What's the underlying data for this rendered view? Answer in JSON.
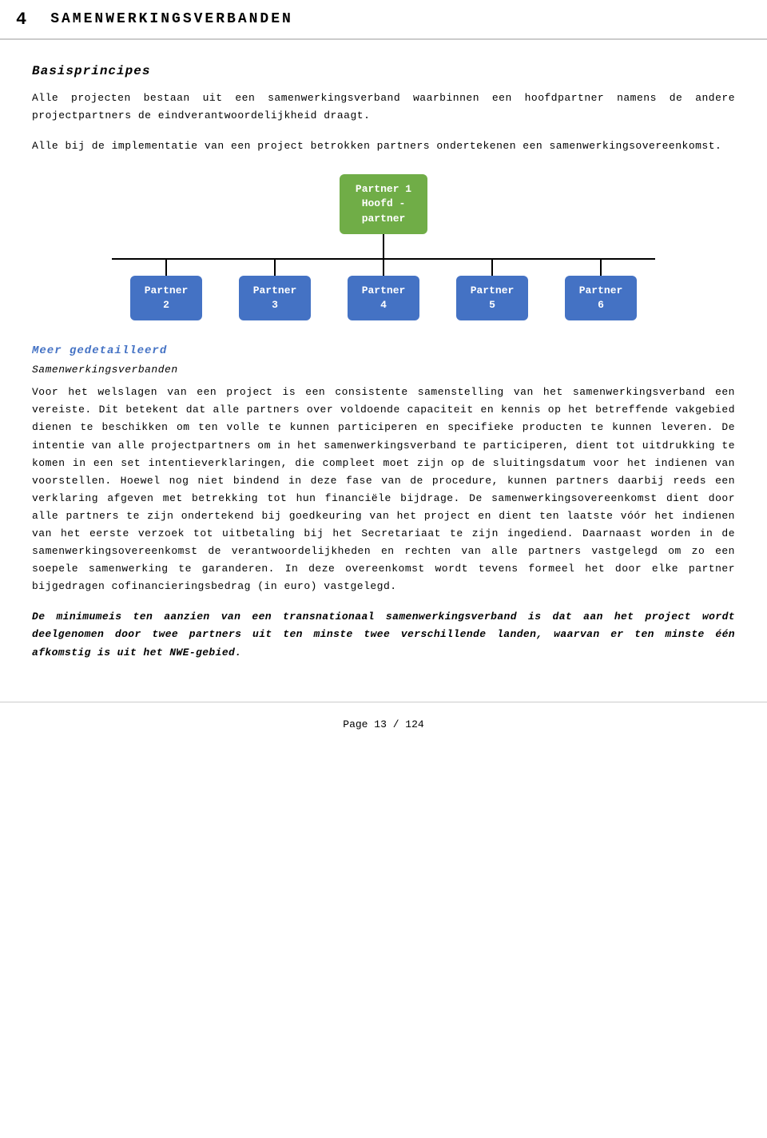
{
  "header": {
    "number": "4",
    "title": "SAMENWERKINGSVERBANDEN"
  },
  "section1": {
    "title": "Basisprincipes",
    "paragraph1": "Alle projecten bestaan uit een samenwerkingsverband waarbinnen een hoofdpartner namens de andere projectpartners de eindverantwoordelijkheid draagt.",
    "paragraph2": "Alle bij de implementatie van een project betrokken partners ondertekenen een samenwerkingsovereenkomst."
  },
  "orgchart": {
    "main_label_line1": "Partner 1",
    "main_label_line2": "Hoofd -",
    "main_label_line3": "partner",
    "partners": [
      {
        "label": "Partner\n2"
      },
      {
        "label": "Partner\n3"
      },
      {
        "label": "Partner\n4"
      },
      {
        "label": "Partner\n5"
      },
      {
        "label": "Partner\n6"
      }
    ]
  },
  "section2": {
    "title": "Meer gedetailleerd",
    "subtitle": "Samenwerkingsverbanden",
    "paragraph1": "Voor het welslagen van een project is een consistente samenstelling van het samenwerkingsverband een vereiste.",
    "paragraph2": "Dit betekent dat alle partners over voldoende capaciteit en kennis op het betreffende vakgebied dienen te beschikken om ten volle te kunnen participeren en specifieke producten te kunnen leveren.",
    "paragraph3": "De intentie van alle projectpartners om in het samenwerkingsverband te participeren, dient tot uitdrukking te komen in een set intentieverklaringen, die compleet moet zijn op de sluitingsdatum voor het indienen van voorstellen.",
    "paragraph4": "Hoewel nog niet bindend in deze fase van de procedure, kunnen partners daarbij reeds een verklaring afgeven met betrekking tot hun financiële bijdrage.",
    "paragraph5": "De samenwerkingsovereenkomst dient door alle partners te zijn ondertekend bij goedkeuring van het project en dient ten laatste vóór het indienen van het eerste verzoek tot uitbetaling bij het Secretariaat te zijn ingediend.",
    "paragraph6": "Daarnaast worden in de samenwerkingsovereenkomst de verantwoordelijkheden en rechten van alle partners vastgelegd om zo een soepele samenwerking te garanderen.",
    "paragraph7": "In deze overeenkomst wordt tevens formeel het door elke partner bijgedragen cofinancieringsbedrag (in euro) vastgelegd.",
    "bold_paragraph": "De minimumeis ten aanzien van een transnationaal samenwerkingsverband is dat aan het project wordt deelgenomen door twee partners uit ten minste twee verschillende landen, waarvan er ten minste één afkomstig is uit het NWE-gebied."
  },
  "footer": {
    "text": "Page 13 / 124"
  }
}
